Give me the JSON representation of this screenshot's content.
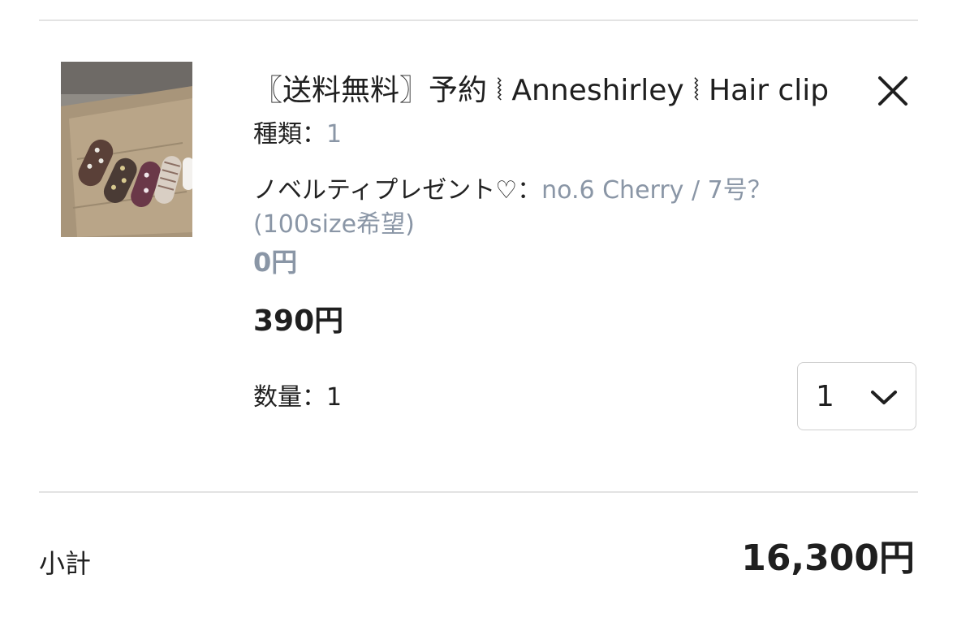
{
  "cart_item": {
    "title": "〖送料無料〗予約 ⦚ Anneshirley ⦚ Hair clip",
    "kind_label": "種類：",
    "kind_value": "1",
    "novelty_label": "ノベルティプレゼント♡：",
    "novelty_value": "no.6 Cherry / 7号？",
    "novelty_value_2": "(100size希望)",
    "option_price": "0円",
    "price": "390円",
    "quantity_label": "数量：1",
    "quantity_selected": "1",
    "image_icon": "product-photo-hair-clips",
    "remove_icon": "close-icon"
  },
  "summary": {
    "subtotal_label": "小計",
    "subtotal_value": "16,300円"
  },
  "colors": {
    "text": "#1f1f1f",
    "muted": "#8a96a6",
    "divider": "#e3e3e3",
    "border": "#cfcfcf"
  }
}
